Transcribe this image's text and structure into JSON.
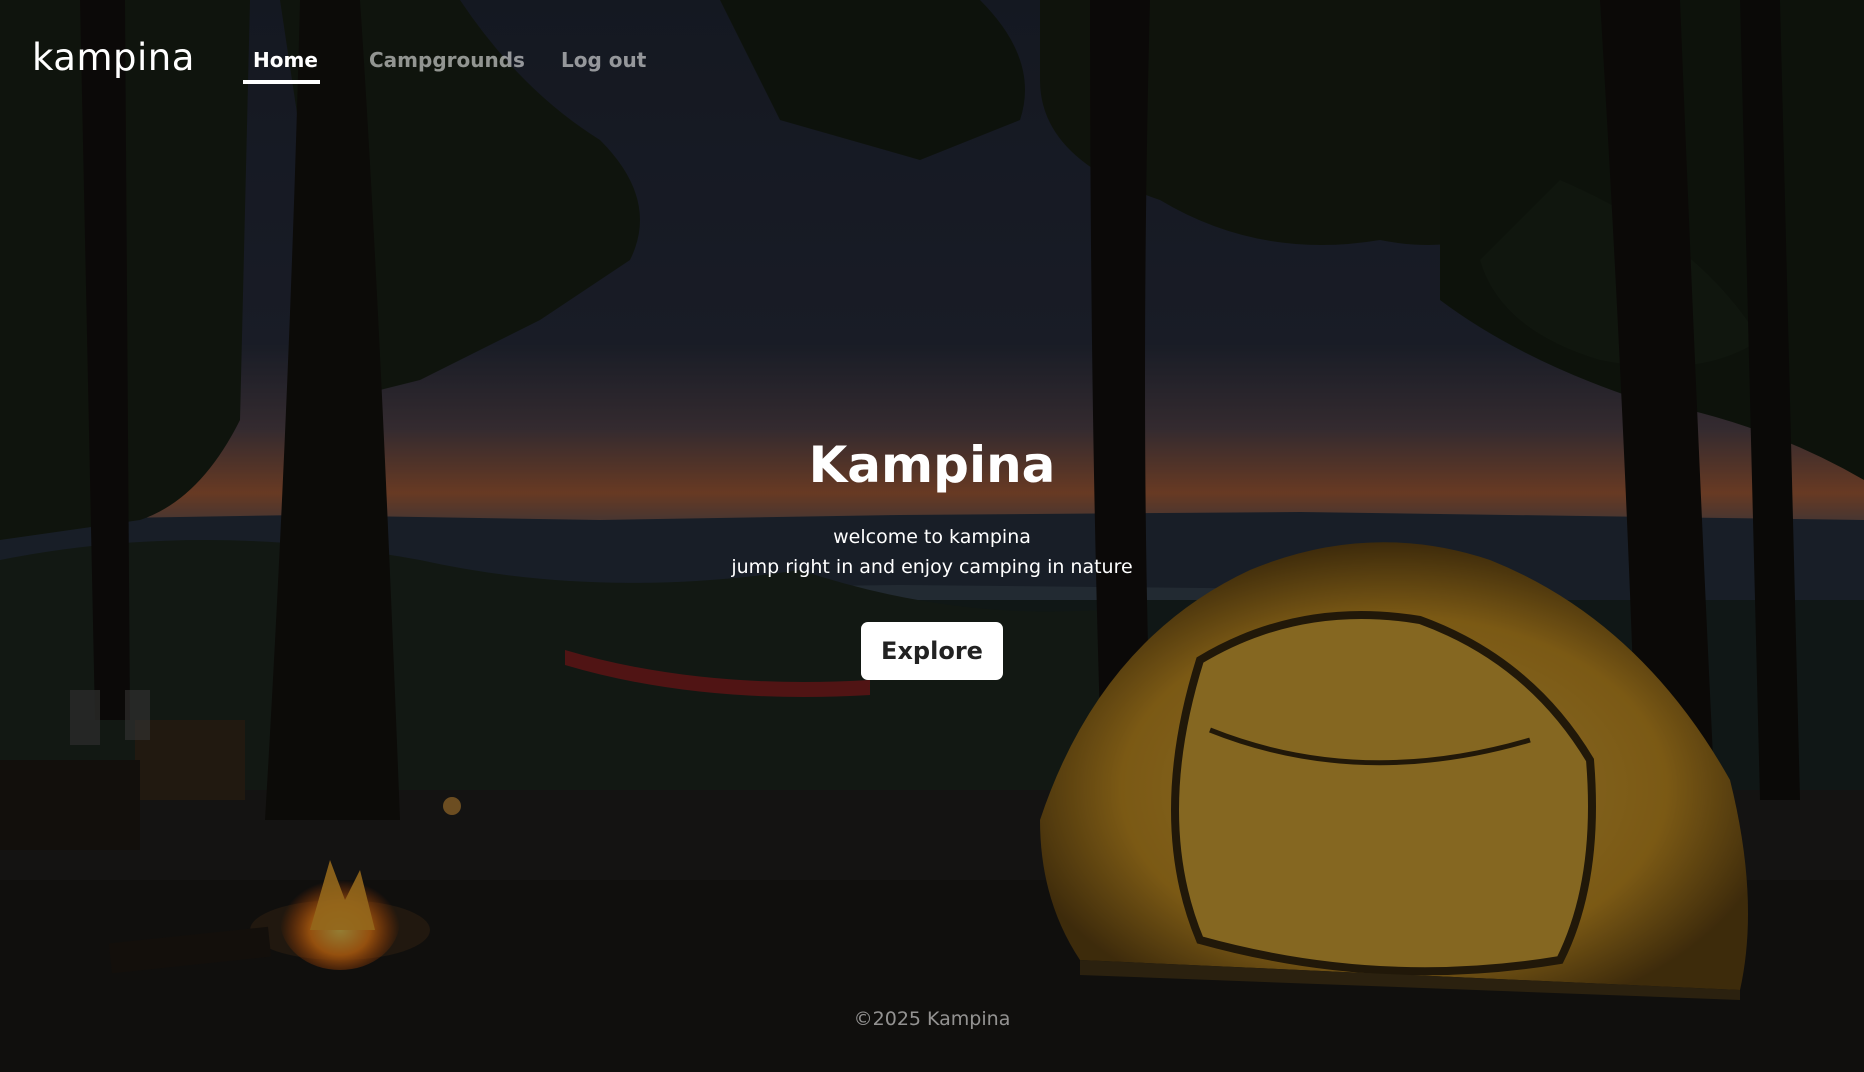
{
  "nav": {
    "brand": "kampina",
    "links": [
      {
        "label": "Home",
        "active": true
      },
      {
        "label": "Campgrounds",
        "active": false
      },
      {
        "label": "Log out",
        "active": false
      }
    ]
  },
  "hero": {
    "title": "Kampina",
    "lead_line1": "welcome to kampina",
    "lead_line2": "jump right in and enjoy camping in nature",
    "button_label": "Explore"
  },
  "footer": {
    "text": "©2025 Kampina"
  },
  "colors": {
    "text_primary": "#ffffff",
    "text_muted": "#9a9a9a",
    "button_bg": "#ffffff",
    "button_text": "#222222",
    "sky_top": "#272c3a",
    "sunset": "#c8623a",
    "tent": "#d9a52c"
  },
  "background": {
    "icon": "campsite-night-photo"
  }
}
